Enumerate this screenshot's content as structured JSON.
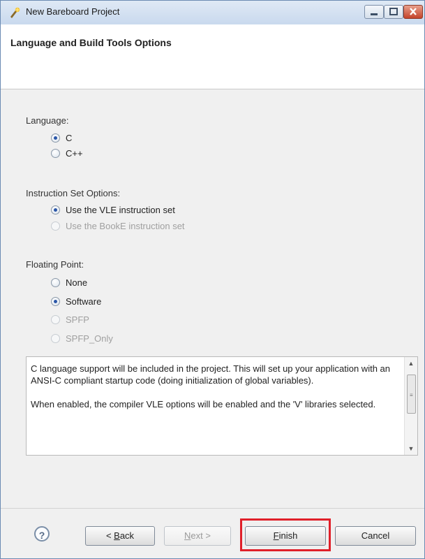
{
  "window": {
    "title": "New Bareboard Project"
  },
  "header": {
    "title": "Language and Build Tools Options"
  },
  "language": {
    "label": "Language:",
    "options": [
      {
        "label": "C",
        "checked": true,
        "enabled": true
      },
      {
        "label": "C++",
        "checked": false,
        "enabled": true
      }
    ]
  },
  "instruction_set": {
    "label": "Instruction Set Options:",
    "options": [
      {
        "label": "Use the VLE instruction set",
        "checked": true,
        "enabled": true
      },
      {
        "label": "Use the BookE instruction set",
        "checked": false,
        "enabled": false
      }
    ]
  },
  "floating_point": {
    "label": "Floating Point:",
    "options": [
      {
        "label": "None",
        "checked": false,
        "enabled": true
      },
      {
        "label": "Software",
        "checked": true,
        "enabled": true
      },
      {
        "label": "SPFP",
        "checked": false,
        "enabled": false
      },
      {
        "label": "SPFP_Only",
        "checked": false,
        "enabled": false
      }
    ]
  },
  "description": {
    "paragraph1": "C language support will be included in the project. This will set up your application with an ANSI-C compliant startup code (doing initialization of global variables).",
    "paragraph2": "When enabled, the compiler VLE options will be enabled and the 'V' libraries selected."
  },
  "buttons": {
    "help": "?",
    "back_prefix": "< ",
    "back_mnemonic": "B",
    "back_rest": "ack",
    "next_mnemonic": "N",
    "next_rest": "ext >",
    "finish_mnemonic": "F",
    "finish_rest": "inish",
    "cancel": "Cancel"
  },
  "colors": {
    "highlight": "#e0202a",
    "titlebar": "#c9d9ee"
  }
}
